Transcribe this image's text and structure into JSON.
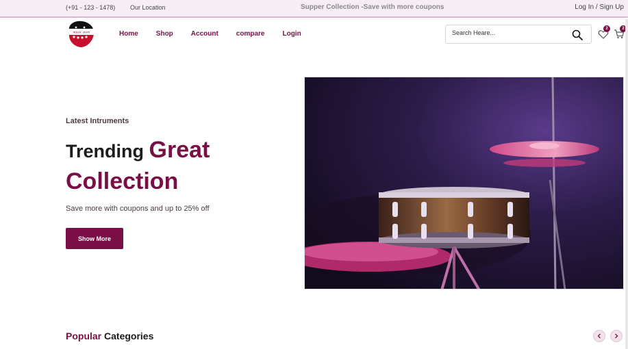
{
  "topbar": {
    "phone": "(+91 - 123 - 1478)",
    "location": "Our Location",
    "promo": "Supper Collection -Save with more coupons",
    "auth": "Log In / Sign Up"
  },
  "logo": {
    "text": "music store"
  },
  "nav": {
    "items": [
      {
        "label": "Home"
      },
      {
        "label": "Shop"
      },
      {
        "label": "Account"
      },
      {
        "label": "compare"
      },
      {
        "label": "Login"
      }
    ]
  },
  "search": {
    "placeholder": "Search Heare...",
    "icon": "search-icon"
  },
  "header_icons": {
    "wishlist_count": "2",
    "cart_count": "2"
  },
  "hero": {
    "subtitle": "Latest Intruments",
    "title_part1": "Trending",
    "title_accent": "Great",
    "title_line2": "Collection",
    "description": "Save more with coupons and up to 25% off",
    "button_label": "Show More"
  },
  "categories": {
    "title_accent": "Popular",
    "title_rest": "Categories"
  },
  "colors": {
    "brand": "#7a0f45",
    "topbar_bg": "#f7eef5"
  }
}
